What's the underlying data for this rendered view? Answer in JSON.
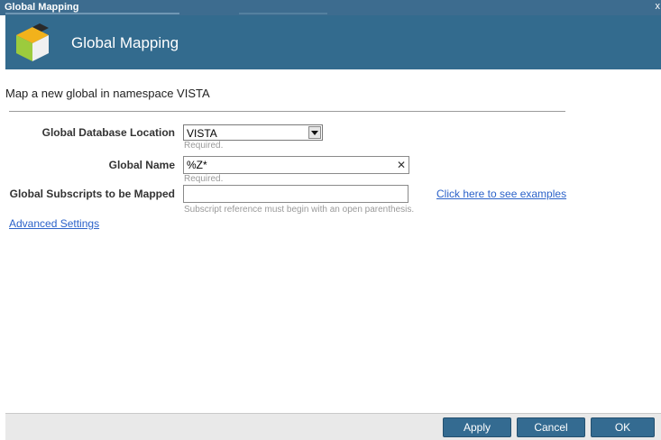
{
  "window": {
    "title": "Global Mapping",
    "close_glyph": "x"
  },
  "header": {
    "title": "Global Mapping",
    "icon": "cube-icon"
  },
  "subtitle": "Map a new global in namespace VISTA",
  "form": {
    "location": {
      "label": "Global Database Location",
      "value": "VISTA",
      "hint": "Required."
    },
    "name": {
      "label": "Global Name",
      "value": "%Z*",
      "hint": "Required."
    },
    "subscripts": {
      "label": "Global Subscripts to be Mapped",
      "value": "",
      "hint": "Subscript reference must begin with an open parenthesis.",
      "examples_link": "Click here to see examples"
    },
    "advanced_link": "Advanced Settings"
  },
  "buttons": {
    "apply": "Apply",
    "cancel": "Cancel",
    "ok": "OK"
  },
  "colors": {
    "header": "#336b8e",
    "titlebar": "#3d6c8f",
    "button": "#346b91",
    "link": "#2b62c9"
  }
}
